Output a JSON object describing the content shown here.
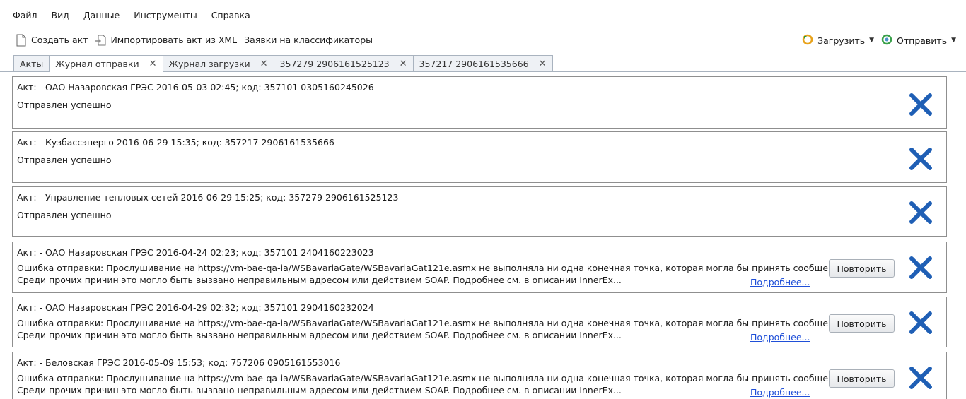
{
  "menu": [
    "Файл",
    "Вид",
    "Данные",
    "Инструменты",
    "Справка"
  ],
  "toolbar": {
    "create_act": "Создать акт",
    "import_xml": "Импортировать акт из XML",
    "classifier_requests": "Заявки на классификаторы",
    "download": "Загрузить",
    "send": "Отправить"
  },
  "tabs": [
    {
      "label": "Акты",
      "closable": false,
      "active": false
    },
    {
      "label": "Журнал отправки",
      "closable": true,
      "active": true
    },
    {
      "label": "Журнал загрузки",
      "closable": true,
      "active": false
    },
    {
      "label": "357279 2906161525123",
      "closable": true,
      "active": false
    },
    {
      "label": "357217 2906161535666",
      "closable": true,
      "active": false
    }
  ],
  "entries": [
    {
      "title": "Акт:  - ОАО Назаровская ГРЭС 2016-05-03 02:45; код: 357101 0305160245026",
      "status": "Отправлен успешно",
      "error": false
    },
    {
      "title": "Акт:  - Кузбассэнерго 2016-06-29 15:35; код: 357217 2906161535666",
      "status": "Отправлен успешно",
      "error": false
    },
    {
      "title": "Акт:  - Управление тепловых сетей 2016-06-29 15:25; код: 357279 2906161525123",
      "status": "Отправлен успешно",
      "error": false
    },
    {
      "title": "Акт:  - ОАО Назаровская ГРЭС 2016-04-24 02:23; код: 357101 2404160223023",
      "error": true,
      "error_line1": "Ошибка отправки: Прослушивание на https://vm-bae-qa-ia/WSBavariaGate/WSBavariaGat121e.asmx не выполняла ни одна конечная точка, которая могла бы принять сообщение.",
      "error_line2": "Среди прочих причин это могло быть вызвано неправильным адресом или действием SOAP. Подробнее см. в описании InnerEx...",
      "more": "Подробнее...",
      "retry": "Повторить"
    },
    {
      "title": "Акт:  - ОАО Назаровская ГРЭС 2016-04-29 02:32; код: 357101 2904160232024",
      "error": true,
      "error_line1": "Ошибка отправки: Прослушивание на https://vm-bae-qa-ia/WSBavariaGate/WSBavariaGat121e.asmx не выполняла ни одна конечная точка, которая могла бы принять сообщение.",
      "error_line2": "Среди прочих причин это могло быть вызвано неправильным адресом или действием SOAP. Подробнее см. в описании InnerEx...",
      "more": "Подробнее...",
      "retry": "Повторить"
    },
    {
      "title": "Акт:  - Беловская ГРЭС  2016-05-09 15:53; код: 757206 0905161553016",
      "error": true,
      "error_line1": "Ошибка отправки: Прослушивание на https://vm-bae-qa-ia/WSBavariaGate/WSBavariaGat121e.asmx не выполняла ни одна конечная точка, которая могла бы принять сообщение.",
      "error_line2": "Среди прочих причин это могло быть вызвано неправильным адресом или действием SOAP. Подробнее см. в описании InnerEx...",
      "more": "Подробнее...",
      "retry": "Повторить"
    }
  ],
  "colors": {
    "close_x": "#1f5fb5",
    "link": "#1f4fd8",
    "border": "#8f8f8f"
  },
  "icons": {
    "create_act": "document-icon",
    "import_xml": "import-icon",
    "download": "refresh-download-icon",
    "send": "send-icon",
    "remove": "close-x-icon"
  }
}
